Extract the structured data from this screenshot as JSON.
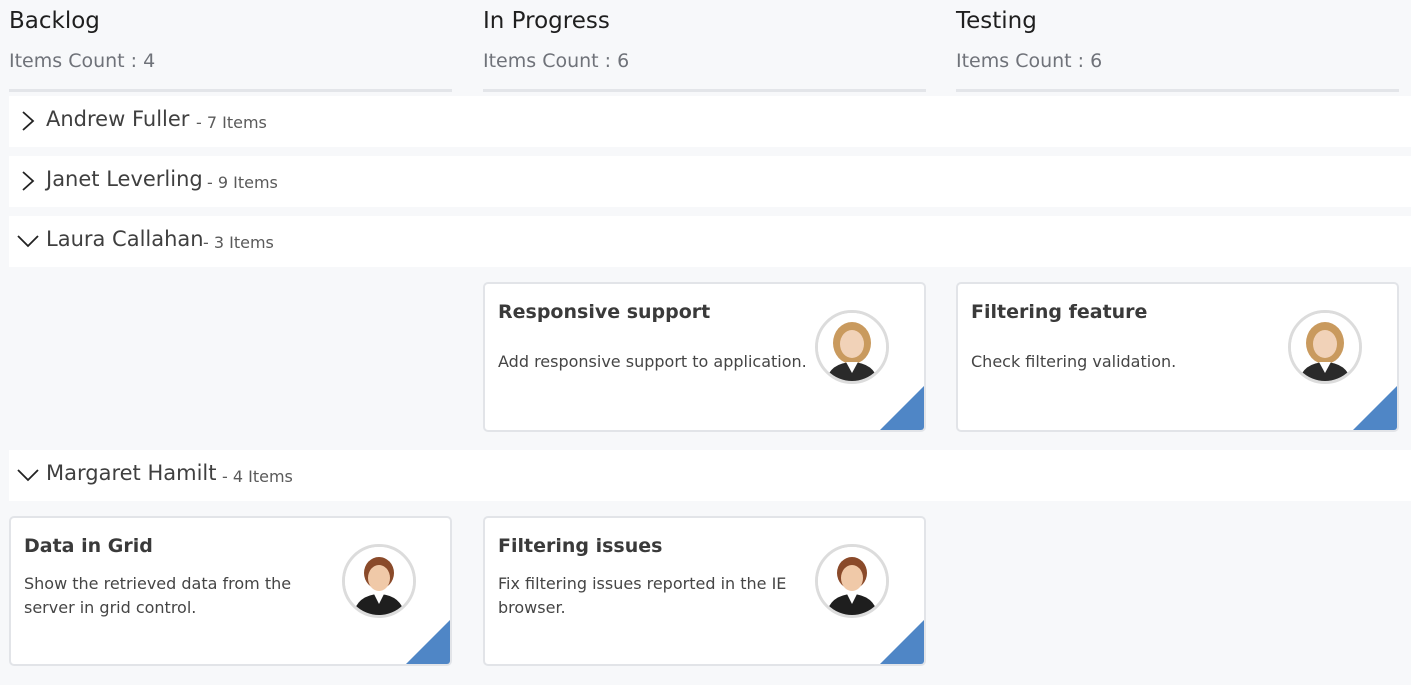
{
  "columns": [
    {
      "title": "Backlog",
      "count": "Items Count : 4"
    },
    {
      "title": "In Progress",
      "count": "Items Count : 6"
    },
    {
      "title": "Testing",
      "count": "Items Count : 6"
    }
  ],
  "swimlanes": [
    {
      "name": "Andrew Fuller",
      "count": "- 7 Items",
      "state": "collapsed"
    },
    {
      "name": "Janet Leverling",
      "count": "- 9 Items",
      "state": "collapsed"
    },
    {
      "name": "Laura Callahan",
      "count": "- 3 Items",
      "state": "expanded"
    },
    {
      "name": "Margaret Hamilt",
      "count": "- 4 Items",
      "state": "expanded"
    }
  ],
  "cards": [
    {
      "title": "Responsive support",
      "description": "Add responsive support to application.",
      "avatar": "laura-callahan-avatar"
    },
    {
      "title": "Filtering feature",
      "description": "Check filtering validation.",
      "avatar": "laura-callahan-avatar"
    },
    {
      "title": "Data in Grid",
      "description": "Show the retrieved data from the server in grid control.",
      "avatar": "margaret-hamilt-avatar"
    },
    {
      "title": "Filtering issues",
      "description": "Fix filtering issues reported in the IE browser.",
      "avatar": "margaret-hamilt-avatar"
    }
  ],
  "colors": {
    "accent": "#4f86c6",
    "background": "#f7f8fa",
    "lane_background": "#ffffff",
    "card_border": "#e2e4e8"
  },
  "icons": {
    "collapsed": "chevron-right-icon",
    "expanded": "chevron-down-icon"
  }
}
